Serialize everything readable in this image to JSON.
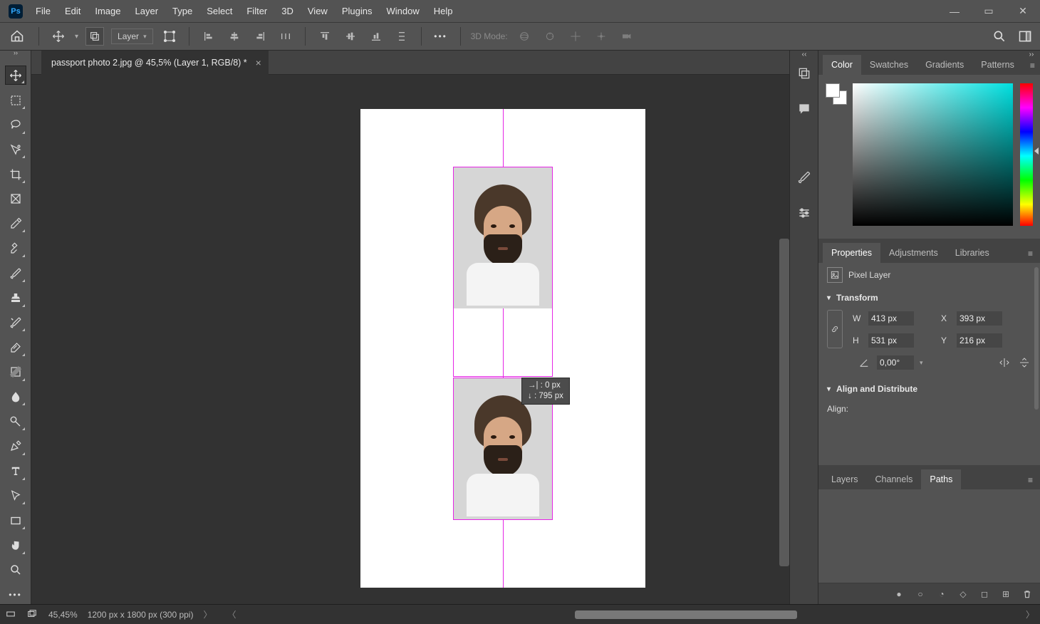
{
  "menu": [
    "File",
    "Edit",
    "Image",
    "Layer",
    "Type",
    "Select",
    "Filter",
    "3D",
    "View",
    "Plugins",
    "Window",
    "Help"
  ],
  "app_logo": "Ps",
  "optionsbar": {
    "layer_dropdown": "Layer",
    "mode_label": "3D Mode:"
  },
  "document": {
    "tab_title": "passport photo 2.jpg @ 45,5% (Layer 1, RGB/8) *",
    "move_tooltip_a": "→| :     0 px",
    "move_tooltip_b": "↓  : 795 px"
  },
  "panels": {
    "color_tabs": [
      "Color",
      "Swatches",
      "Gradients",
      "Patterns"
    ],
    "color_active": 0,
    "props_tabs": [
      "Properties",
      "Adjustments",
      "Libraries"
    ],
    "props_active": 0,
    "pixel_layer_label": "Pixel Layer",
    "transform_label": "Transform",
    "W_label": "W",
    "W_value": "413 px",
    "H_label": "H",
    "H_value": "531 px",
    "X_label": "X",
    "X_value": "393 px",
    "Y_label": "Y",
    "Y_value": "216 px",
    "angle_value": "0,00°",
    "align_section": "Align and Distribute",
    "align_label": "Align:",
    "layers_tabs": [
      "Layers",
      "Channels",
      "Paths"
    ],
    "layers_active": 2
  },
  "statusbar": {
    "zoom": "45,45%",
    "doc_info": "1200 px x 1800 px (300 ppi)"
  }
}
